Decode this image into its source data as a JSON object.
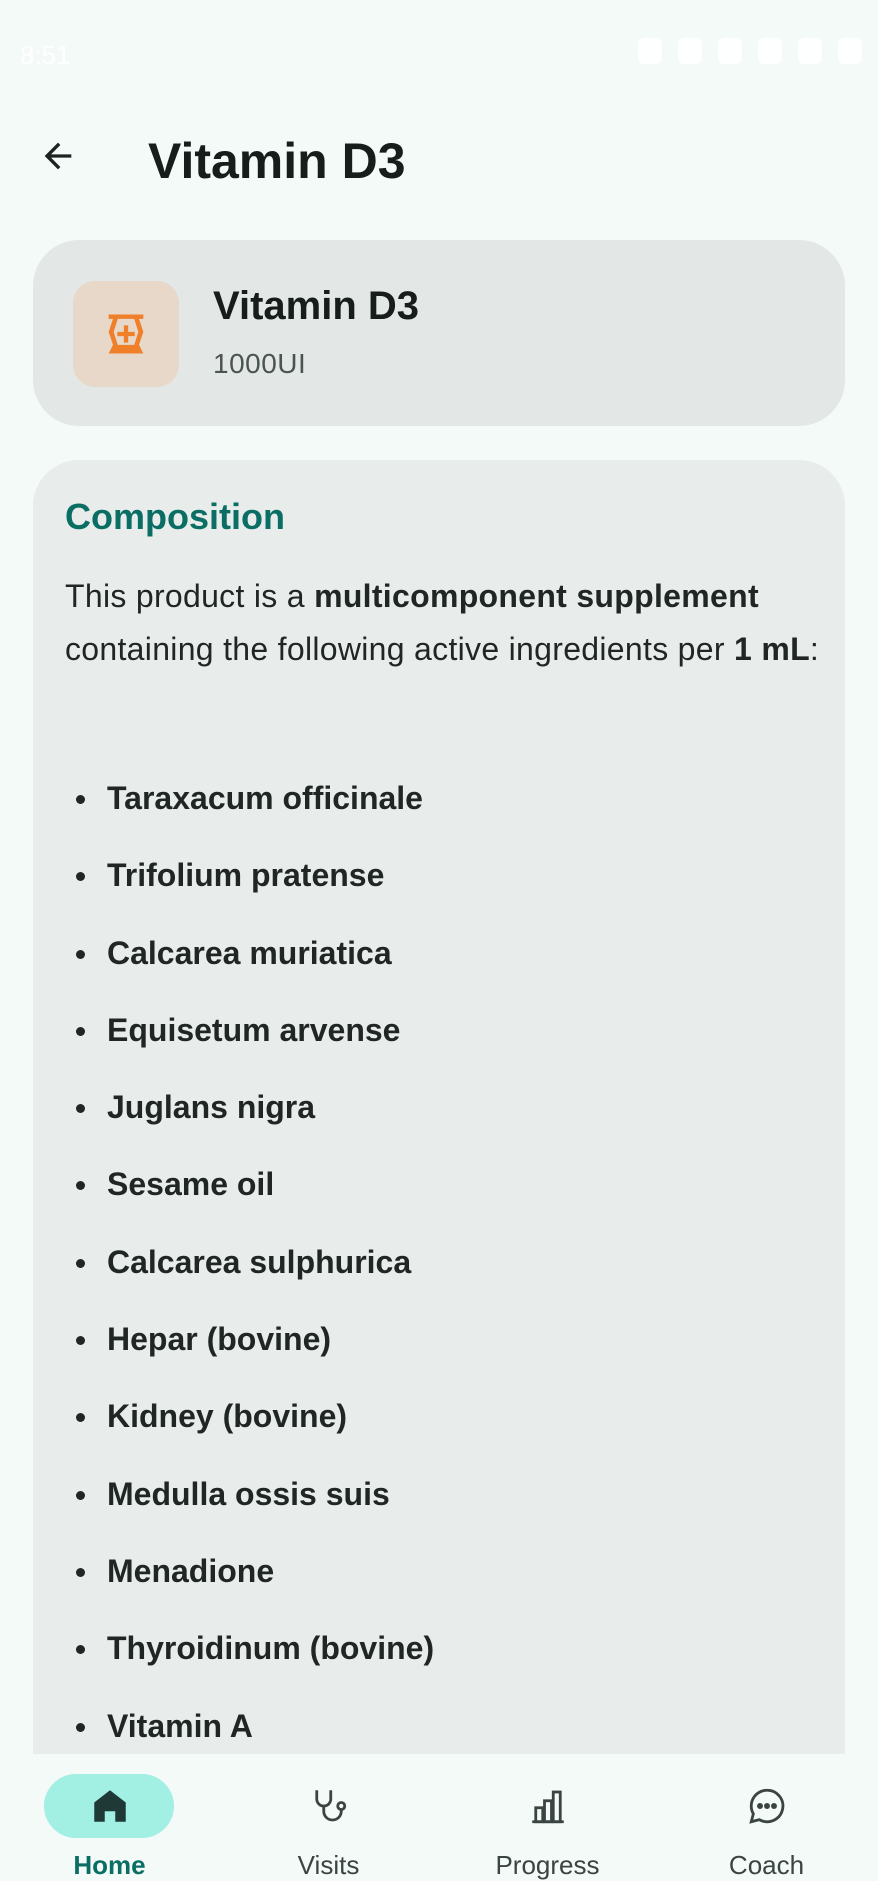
{
  "status_bar": {
    "time": "8:51"
  },
  "header": {
    "title": "Vitamin D3"
  },
  "product": {
    "name": "Vitamin D3",
    "dose": "1000UI",
    "icon": "medicine-jar-icon"
  },
  "composition": {
    "heading": "Composition",
    "intro_part1": "This product is a ",
    "intro_bold": "multicomponent supplement",
    "intro_part2": " containing the following active ingredients per ",
    "intro_unit": "1 mL",
    "intro_end": ":",
    "ingredients": [
      "Taraxacum officinale",
      "Trifolium pratense",
      "Calcarea muriatica",
      "Equisetum arvense",
      "Juglans nigra",
      "Sesame oil",
      "Calcarea sulphurica",
      "Hepar (bovine)",
      "Kidney (bovine)",
      "Medulla ossis suis",
      "Menadione",
      "Thyroidinum (bovine)",
      "Vitamin A"
    ]
  },
  "nav": {
    "items": [
      {
        "label": "Home",
        "icon": "home-icon",
        "active": true
      },
      {
        "label": "Visits",
        "icon": "stethoscope-icon",
        "active": false
      },
      {
        "label": "Progress",
        "icon": "bar-chart-icon",
        "active": false
      },
      {
        "label": "Coach",
        "icon": "chat-bubble-icon",
        "active": false
      }
    ]
  },
  "colors": {
    "accent": "#0b6e64",
    "nav_active_pill": "#a2efe3",
    "product_icon": "#f07f2a"
  }
}
